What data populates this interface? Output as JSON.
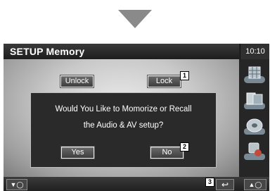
{
  "header": {
    "title": "SETUP Memory",
    "clock": "10:10"
  },
  "buttons": {
    "unlock": "Unlock",
    "lock": "Lock",
    "yes": "Yes",
    "no": "No"
  },
  "dialog": {
    "line1": "Would You Like to Momorize or Recall",
    "line2": "the Audio & AV setup?"
  },
  "callouts": [
    "1",
    "2",
    "3"
  ],
  "bottom_bar": {
    "left": "▼◯",
    "right": "▲◯",
    "return": "↩"
  },
  "sidebar": {
    "icons": [
      "grid-menu-icon",
      "media-icon",
      "disc-icon",
      "settings-icon"
    ]
  },
  "colors": {
    "background": "#262626",
    "panel_light": "#e9e9e9",
    "arrow": "#8a8a8a"
  }
}
